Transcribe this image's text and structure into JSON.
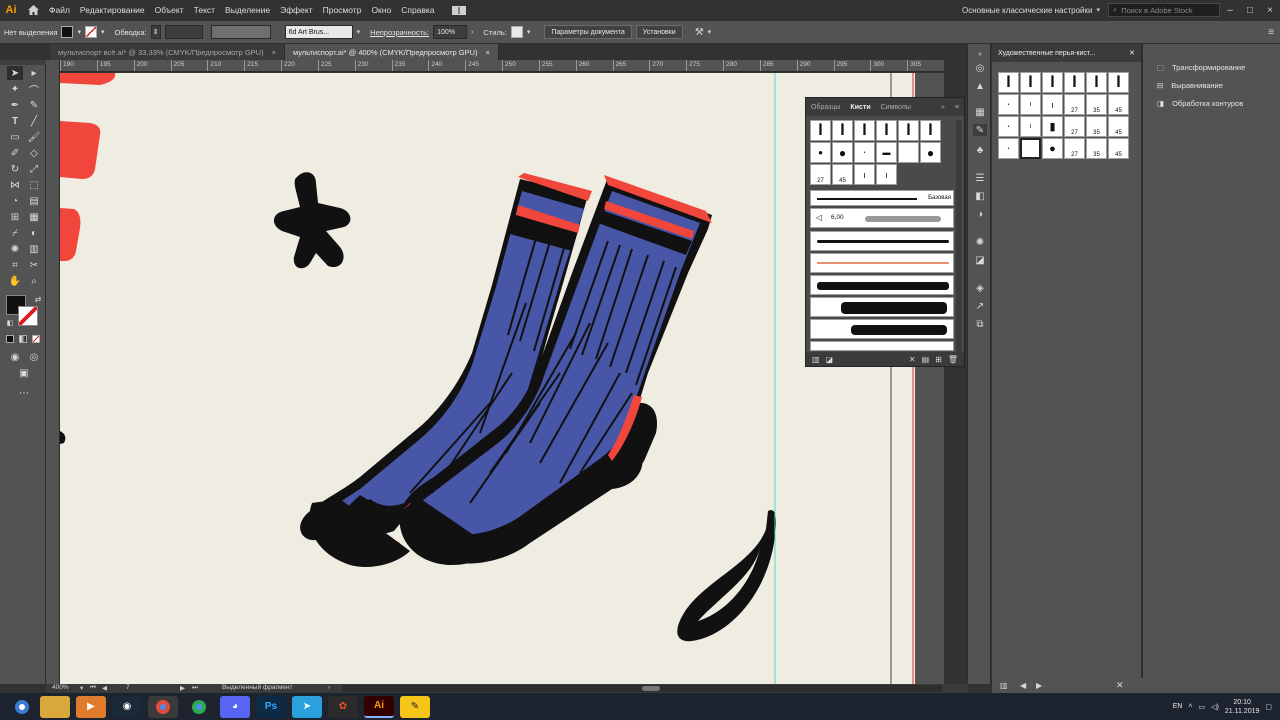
{
  "app": {
    "logo": "Ai",
    "workspace": "Основные классические настройки",
    "search_placeholder": "Поиск в Adobe Stock"
  },
  "menu": [
    "Файл",
    "Редактирование",
    "Объект",
    "Текст",
    "Выделение",
    "Эффект",
    "Просмотр",
    "Окно",
    "Справка"
  ],
  "control": {
    "selection": "Нет выделения",
    "stroke_label": "Обводка:",
    "brush_name": "6d Art Brus...",
    "opacity_label": "Непрозрачность:",
    "opacity_value": "100%",
    "style_label": "Стиль:",
    "doc_setup": "Параметры документа",
    "install": "Установки"
  },
  "tabs": [
    {
      "label": "мультиспорт всё.ai* @ 33,33% (CMYK/Предпросмотр GPU)",
      "close": "×"
    },
    {
      "label": "мультиспорт.ai* @ 400% (CMYK/Предпросмотр GPU)",
      "close": "×"
    }
  ],
  "ruler": [
    "190",
    "195",
    "200",
    "205",
    "210",
    "215",
    "220",
    "225",
    "230",
    "235",
    "240",
    "245",
    "250",
    "255",
    "260",
    "265",
    "270",
    "275",
    "280",
    "285",
    "290",
    "295",
    "300",
    "305"
  ],
  "brushes_panel": {
    "tabs": [
      "Образцы",
      "Кисти",
      "Символы"
    ],
    "active_tab": "Кисти",
    "labels": [
      "27",
      "45"
    ],
    "basic_label": "Базовая",
    "size_label": "6,00"
  },
  "art_panel": {
    "title": "Художественные перья-кист...",
    "labels": [
      "27",
      "35",
      "45"
    ]
  },
  "side_panel": [
    "Трансформирование",
    "Выравнивание",
    "Обработка контуров"
  ],
  "status": {
    "zoom": "400%",
    "page": "7",
    "info": "Выделенный фрагмент"
  },
  "tray": {
    "lang": "EN",
    "time": "20:10",
    "date": "21.11.2019"
  },
  "taskbar": [
    "Edge",
    "Files",
    "Player",
    "Steam",
    "Chrome",
    "Chrome",
    "Discord",
    "Ps",
    "Telegram",
    "Figma",
    "Ai",
    "Notes"
  ],
  "colors": {
    "sock_blue": "#4856a8",
    "sock_red": "#f0463c",
    "ink": "#111111",
    "artboard": "#efece2"
  }
}
